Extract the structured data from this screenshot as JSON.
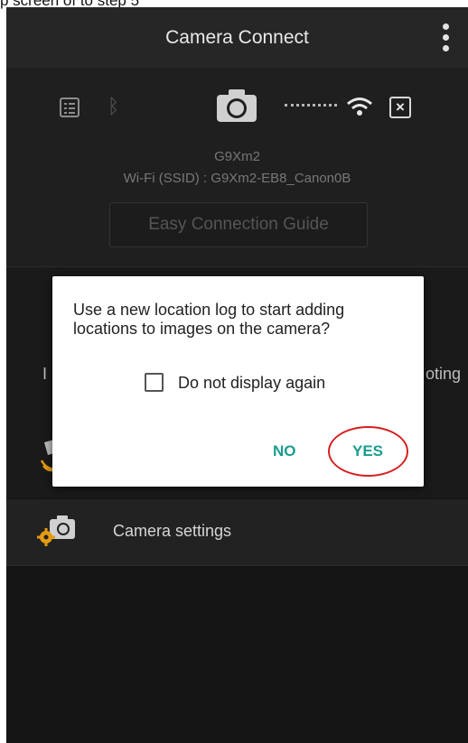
{
  "caption": {
    "text": "p screen of to step 5"
  },
  "appbar": {
    "title": "Camera Connect"
  },
  "status": {
    "icons": [
      "list-icon",
      "bluetooth-icon",
      "camera-icon",
      "connection-dots-icon",
      "wifi-icon",
      "close-icon"
    ],
    "bluetooth_glyph": "ᛒ",
    "close_glyph": "×",
    "model": "G9Xm2",
    "ssid": "Wi-Fi (SSID) :  G9Xm2-EB8_Canon0B",
    "guide_button": "Easy Connection Guide"
  },
  "functions": {
    "left_partial": "I",
    "right_partial": "oting"
  },
  "settings": {
    "label": "Camera settings"
  },
  "dialog": {
    "message": "Use a new location log to start adding locations to images on the camera?",
    "checkbox_label": "Do not display again",
    "checkbox_checked": false,
    "no_label": "NO",
    "yes_label": "YES",
    "accent_color": "#1a9d8e",
    "highlight_color": "#d62020"
  }
}
